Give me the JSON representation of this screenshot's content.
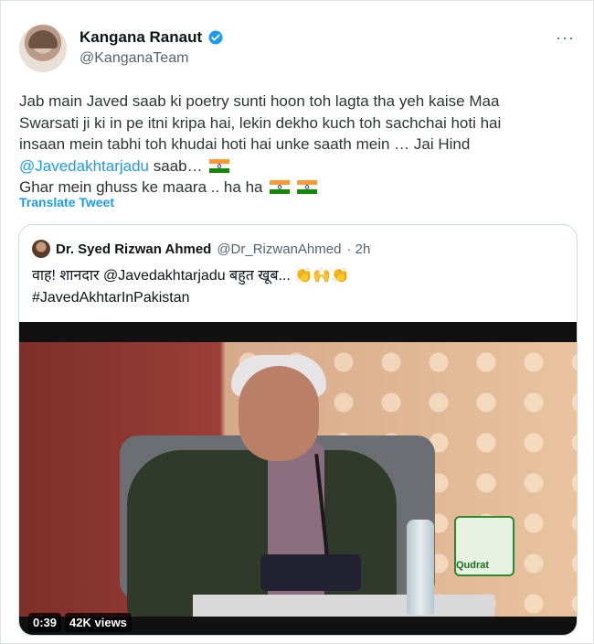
{
  "author": {
    "display_name": "Kangana Ranaut",
    "handle": "@KanganaTeam",
    "verified": true
  },
  "tweet": {
    "line1": "Jab main Javed saab ki poetry sunti hoon toh lagta tha yeh kaise Maa",
    "line2": "Swarsati ji ki in pe itni kripa hai, lekin dekho kuch toh sachchai hoti hai",
    "line3": "insaan mein tabhi toh khudai hoti hai unke saath mein … Jai Hind",
    "mention": "@Javedakhtarjadu",
    "after_mention": " saab…",
    "line5": "Ghar mein ghuss ke maara .. ha ha",
    "translate_label": "Translate Tweet"
  },
  "quoted": {
    "display_name": "Dr. Syed Rizwan Ahmed",
    "handle": "@Dr_RizwanAhmed",
    "time": "· 2h",
    "line1": "वाह! शानदार @Javedakhtarjadu बहुत खूब...",
    "line2": "#JavedAkhtarInPakistan",
    "video": {
      "duration": "0:39",
      "views": "42K views",
      "watermark": "Qudrat"
    }
  },
  "colors": {
    "link": "#1d9bf0",
    "muted": "#536471"
  },
  "icons": [
    "verified-icon",
    "more-icon",
    "india-flag-icon",
    "clap-icon",
    "raised-hands-icon"
  ]
}
